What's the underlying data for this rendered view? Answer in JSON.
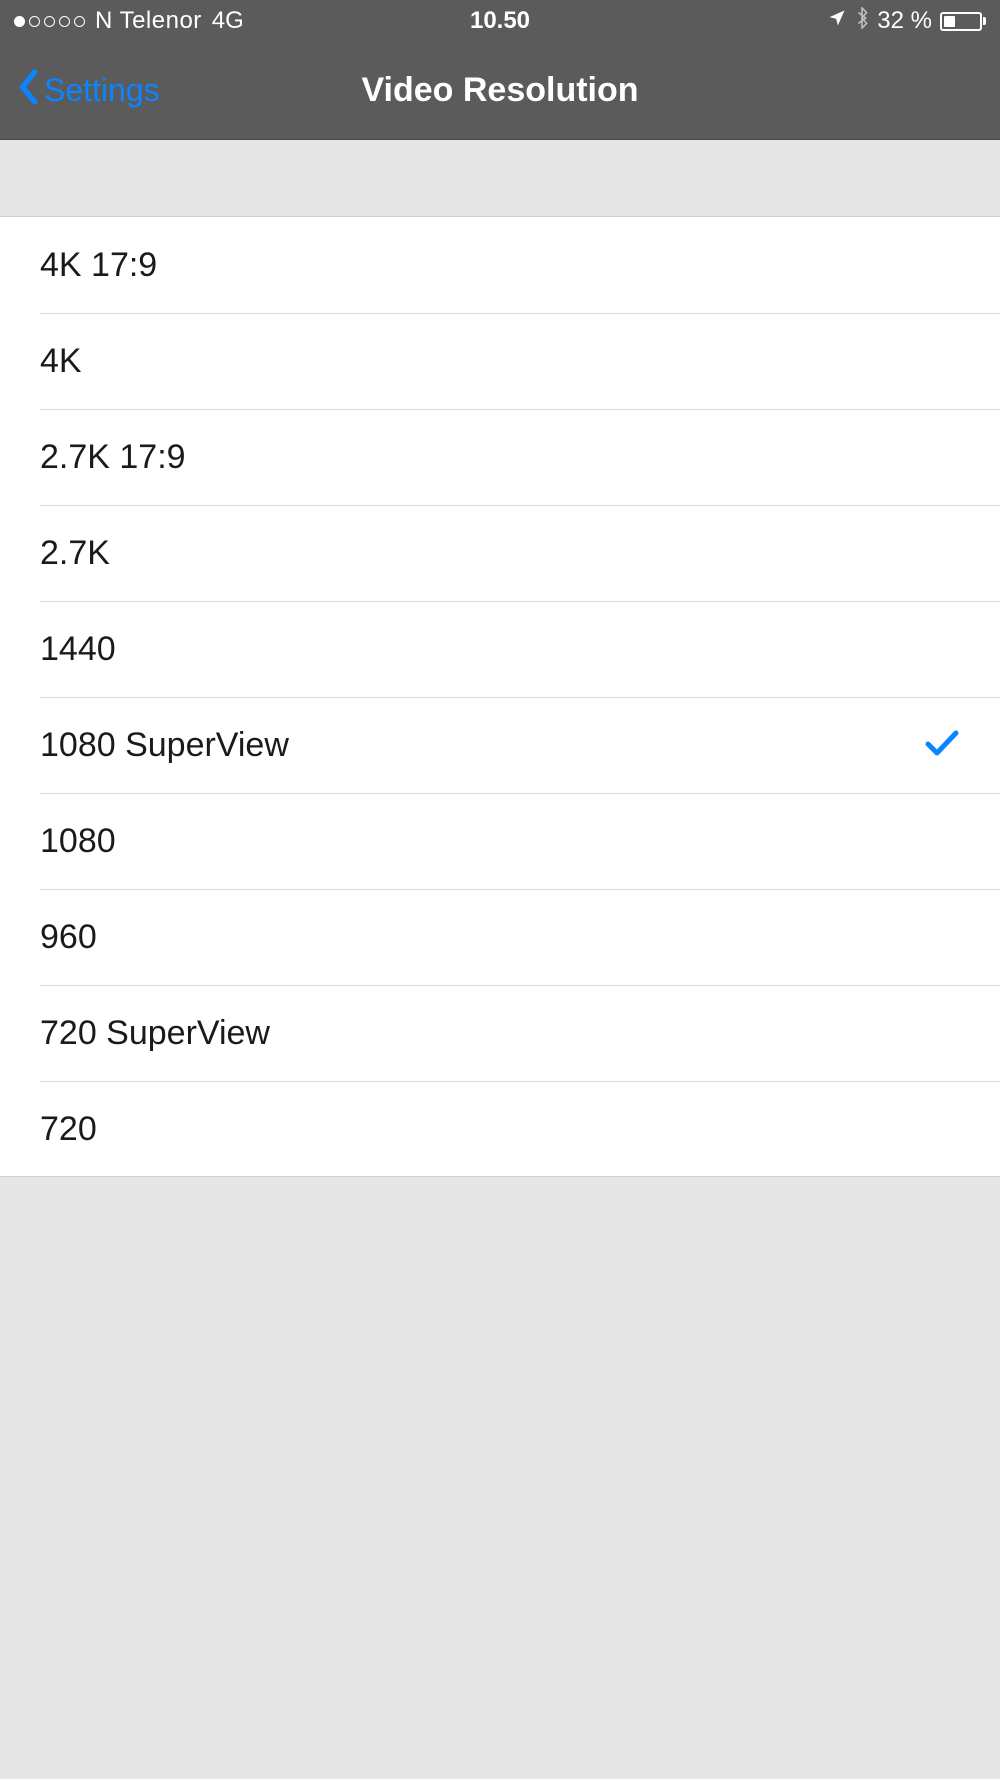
{
  "status": {
    "carrier": "N Telenor",
    "network": "4G",
    "time": "10.50",
    "battery_pct": "32 %"
  },
  "nav": {
    "back_label": "Settings",
    "title": "Video Resolution"
  },
  "options": [
    {
      "label": "4K 17:9",
      "selected": false
    },
    {
      "label": "4K",
      "selected": false
    },
    {
      "label": "2.7K 17:9",
      "selected": false
    },
    {
      "label": "2.7K",
      "selected": false
    },
    {
      "label": "1440",
      "selected": false
    },
    {
      "label": "1080 SuperView",
      "selected": true
    },
    {
      "label": "1080",
      "selected": false
    },
    {
      "label": "960",
      "selected": false
    },
    {
      "label": "720 SuperView",
      "selected": false
    },
    {
      "label": "720",
      "selected": false
    }
  ],
  "colors": {
    "accent": "#0a84ff",
    "header_bg": "#5b5b5b"
  }
}
